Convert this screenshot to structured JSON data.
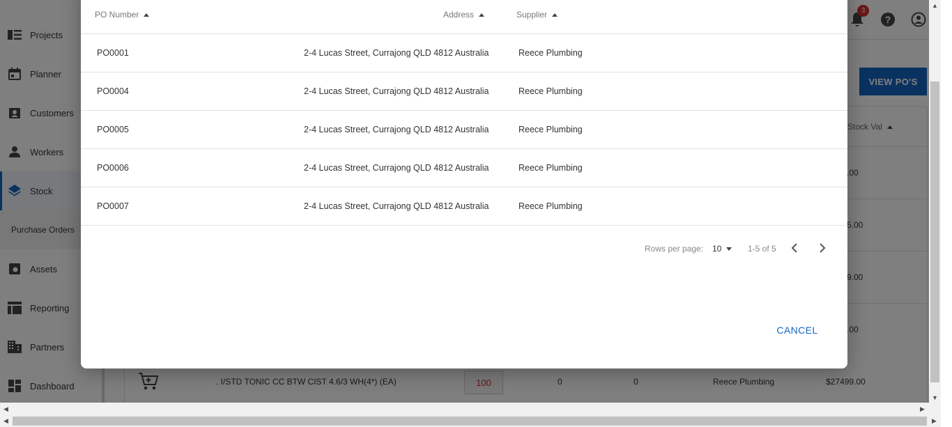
{
  "sidebar": {
    "items": [
      {
        "label": "Projects",
        "icon": "list-icon"
      },
      {
        "label": "Planner",
        "icon": "calendar-icon"
      },
      {
        "label": "Customers",
        "icon": "contact-card-icon"
      },
      {
        "label": "Workers",
        "icon": "person-icon"
      },
      {
        "label": "Stock",
        "icon": "layers-icon"
      },
      {
        "label": "Assets",
        "icon": "asset-icon"
      },
      {
        "label": "Reporting",
        "icon": "table-icon"
      },
      {
        "label": "Partners",
        "icon": "building-icon"
      },
      {
        "label": "Dashboard",
        "icon": "dashboard-icon"
      }
    ],
    "sub_item": "Purchase Orders"
  },
  "topbar": {
    "notification_count": "3"
  },
  "page": {
    "view_pos_label": "VIEW PO'S",
    "stock_val_header": "Stock Val",
    "stock_partials": [
      ".00",
      "5.00",
      "9.00",
      ".00"
    ],
    "stock_row": {
      "description": ". I/STD TONIC CC BTW CIST 4.6/3 WH(4*) (EA)",
      "qty": "100",
      "col_a": "0",
      "col_b": "0",
      "supplier": "Reece Plumbing",
      "value": "$27499.00"
    }
  },
  "dialog": {
    "columns": {
      "po_number": "PO Number",
      "address": "Address",
      "supplier": "Supplier"
    },
    "rows": [
      {
        "po": "PO0001",
        "address": "2-4 Lucas Street, Currajong QLD 4812 Australia",
        "supplier": "Reece Plumbing"
      },
      {
        "po": "PO0004",
        "address": "2-4 Lucas Street, Currajong QLD 4812 Australia",
        "supplier": "Reece Plumbing"
      },
      {
        "po": "PO0005",
        "address": "2-4 Lucas Street, Currajong QLD 4812 Australia",
        "supplier": "Reece Plumbing"
      },
      {
        "po": "PO0006",
        "address": "2-4 Lucas Street, Currajong QLD 4812 Australia",
        "supplier": "Reece Plumbing"
      },
      {
        "po": "PO0007",
        "address": "2-4 Lucas Street, Currajong QLD 4812 Australia",
        "supplier": "Reece Plumbing"
      }
    ],
    "pagination": {
      "rows_per_page_label": "Rows per page:",
      "rows_per_page_value": "10",
      "range": "1-5 of 5"
    },
    "cancel_label": "CANCEL"
  },
  "colors": {
    "accent": "#1565c0",
    "badge": "#d32f2f",
    "qty_text": "#c62828"
  }
}
